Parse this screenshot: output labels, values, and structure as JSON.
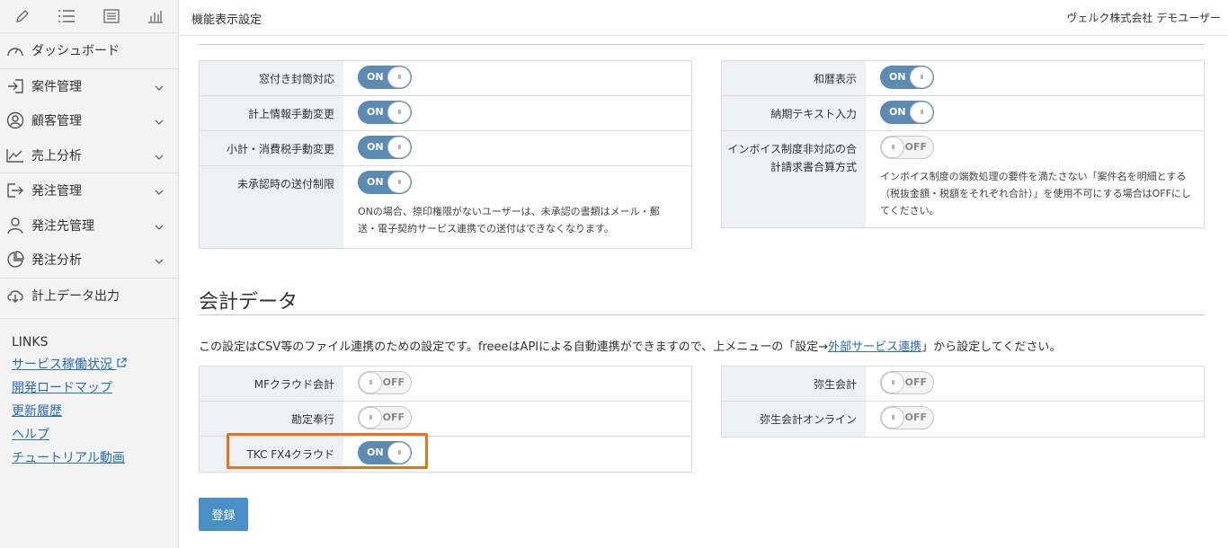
{
  "header": {
    "title": "機能表示設定",
    "user": "ヴェルク株式会社 デモユーザー"
  },
  "sidebar": {
    "items": [
      {
        "label": "ダッシュボード",
        "icon": "gauge-icon"
      },
      {
        "label": "案件管理",
        "icon": "login-icon"
      },
      {
        "label": "顧客管理",
        "icon": "user-circle-icon"
      },
      {
        "label": "売上分析",
        "icon": "line-chart-icon"
      },
      {
        "label": "発注管理",
        "icon": "arrow-box-icon"
      },
      {
        "label": "発注先管理",
        "icon": "person-icon"
      },
      {
        "label": "発注分析",
        "icon": "pie-chart-icon"
      },
      {
        "label": "計上データ出力",
        "icon": "cloud-download-icon"
      }
    ],
    "links_title": "LINKS",
    "links": [
      "サービス稼働状況",
      "開発ロードマップ",
      "更新履歴",
      "ヘルプ",
      "チュートリアル動画"
    ]
  },
  "panel_left": {
    "rows": [
      {
        "label": "窓付き封筒対応",
        "state": "ON"
      },
      {
        "label": "計上情報手動変更",
        "state": "ON"
      },
      {
        "label": "小計・消費税手動変更",
        "state": "ON"
      },
      {
        "label": "未承認時の送付制限",
        "state": "ON",
        "desc": "ONの場合、捺印権限がないユーザーは、未承認の書類はメール・郵送・電子契約サービス連携での送付はできなくなります。"
      }
    ]
  },
  "panel_right": {
    "rows": [
      {
        "label": "和暦表示",
        "state": "ON"
      },
      {
        "label": "納期テキスト入力",
        "state": "ON"
      },
      {
        "label": "インボイス制度非対応の合計請求書合算方式",
        "state": "OFF",
        "desc": "インボイス制度の端数処理の要件を満たさない「案件名を明細とする（税抜金額・税額をそれぞれ合計）」を使用不可にする場合はOFFにしてください。"
      }
    ]
  },
  "accounting": {
    "title": "会計データ",
    "notice_pre": "この設定はCSV等のファイル連携のための設定です。freeeはAPIによる自動連携ができますので、上メニューの「設定→",
    "notice_link": "外部サービス連携",
    "notice_post": "」から設定してください。",
    "left": [
      {
        "label": "MFクラウド会計",
        "state": "OFF"
      },
      {
        "label": "勘定奉行",
        "state": "OFF"
      },
      {
        "label": "TKC FX4クラウド",
        "state": "ON"
      }
    ],
    "right": [
      {
        "label": "弥生会計",
        "state": "OFF"
      },
      {
        "label": "弥生会計オンライン",
        "state": "OFF"
      }
    ]
  },
  "submit_label": "登録",
  "toggle_knob": "III"
}
